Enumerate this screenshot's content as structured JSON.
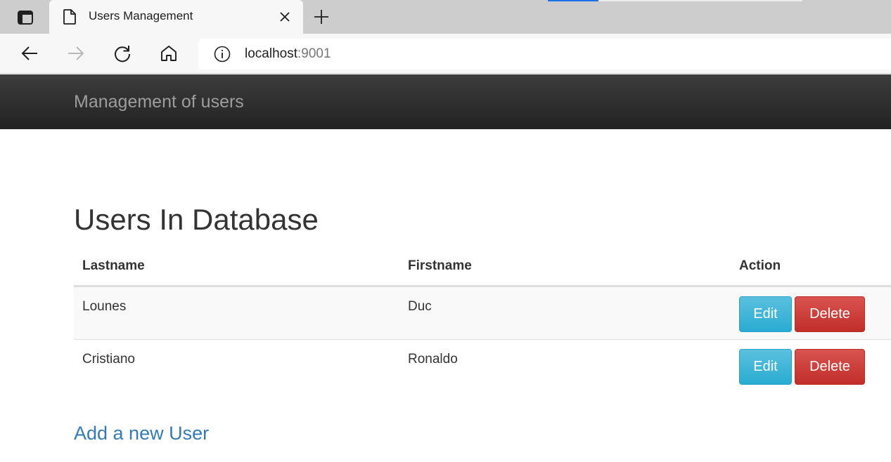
{
  "browser": {
    "tab_title": "Users Management",
    "url_host": "localhost",
    "url_port": ":9001"
  },
  "navbar": {
    "brand": "Management of users"
  },
  "main": {
    "title": "Users In Database",
    "table": {
      "headers": [
        "Lastname",
        "Firstname",
        "Action"
      ],
      "rows": [
        {
          "lastname": "Lounes",
          "firstname": "Duc",
          "edit_label": "Edit",
          "delete_label": "Delete"
        },
        {
          "lastname": "Cristiano",
          "firstname": "Ronaldo",
          "edit_label": "Edit",
          "delete_label": "Delete"
        }
      ]
    },
    "add_link": "Add a new User"
  },
  "colors": {
    "navbar_bg": "#222222",
    "brand_text": "#9d9d9d",
    "link": "#337ab7",
    "edit_button": "#5bc0de",
    "delete_button": "#d9534f"
  },
  "icons": [
    "tab-actions-icon",
    "page-icon",
    "close-icon",
    "plus-icon",
    "back-arrow-icon",
    "forward-arrow-icon",
    "refresh-icon",
    "home-icon",
    "info-icon"
  ]
}
